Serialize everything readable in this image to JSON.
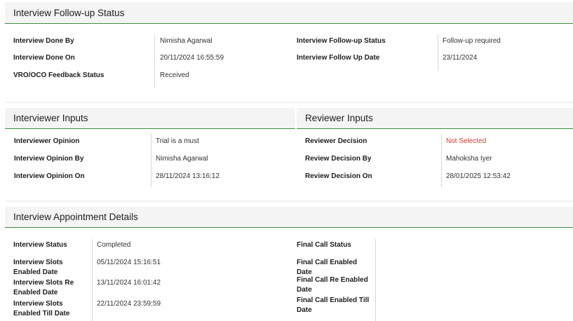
{
  "followup": {
    "title": "Interview Follow-up Status",
    "left": [
      {
        "label": "Interview Done By",
        "value": "Nimisha Agarwal"
      },
      {
        "label": "Interview Done On",
        "value": "20/11/2024 16:55:59"
      },
      {
        "label": "VRO/OCO Feedback Status",
        "value": "Received"
      }
    ],
    "right": [
      {
        "label": "Interview Follow-up Status",
        "value": "Follow-up required"
      },
      {
        "label": "Interview Follow Up Date",
        "value": "23/11/2024"
      }
    ]
  },
  "interviewer": {
    "title": "Interviewer Inputs",
    "rows": [
      {
        "label": "Interviewer Opinion",
        "value": "Trial is a must"
      },
      {
        "label": "Interview Opinion By",
        "value": "Nimisha Agarwal"
      },
      {
        "label": "Interview Opinion On",
        "value": "28/11/2024 13:16:12"
      }
    ]
  },
  "reviewer": {
    "title": "Reviewer Inputs",
    "rows": [
      {
        "label": "Reviewer Decision",
        "value": "Not Selected"
      },
      {
        "label": "Review Decision By",
        "value": "Mahoksha Iyer"
      },
      {
        "label": "Review Decision On",
        "value": "28/01/2025 12:53:42"
      }
    ]
  },
  "appointment": {
    "title": "Interview Appointment Details",
    "left": [
      {
        "label": "Interview Status",
        "value": "Completed"
      },
      {
        "label": "Interview Slots Enabled Date",
        "value": "05/11/2024 15:16:51"
      },
      {
        "label": "Interview Slots Re Enabled Date",
        "value": "13/11/2024 16:01:42"
      },
      {
        "label": "Interview Slots Enabled Till Date",
        "value": "22/11/2024 23:59:59"
      }
    ],
    "right": [
      {
        "label": "Final Call Status",
        "value": ""
      },
      {
        "label": "Final Call Enabled Date",
        "value": ""
      },
      {
        "label": "Final Call Re Enabled Date",
        "value": ""
      },
      {
        "label": "Final Call Enabled Till Date",
        "value": ""
      }
    ]
  },
  "colors": {
    "accent": "#3e8f3e",
    "header_bg": "#f4f4f4",
    "negative": "#d23a2a"
  }
}
